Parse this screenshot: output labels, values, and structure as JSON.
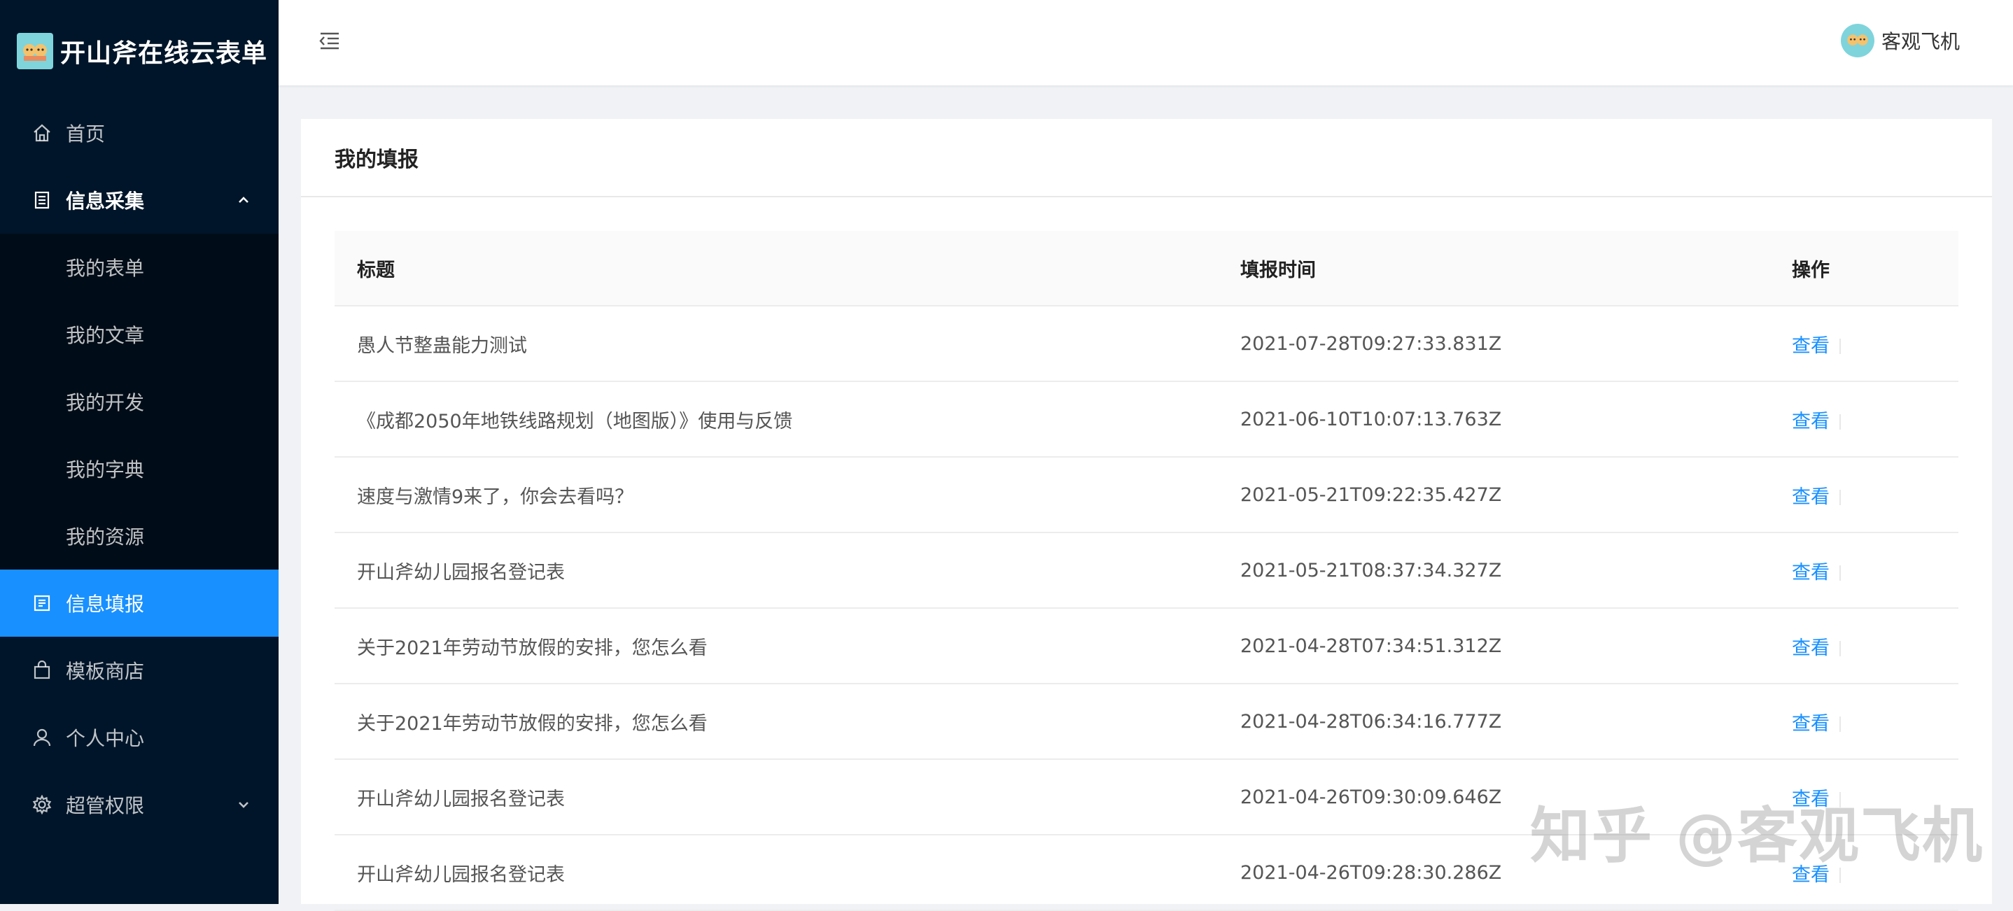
{
  "app": {
    "title": "开山斧在线云表单"
  },
  "sidebar": {
    "items": [
      {
        "label": "首页",
        "icon": "home-icon"
      },
      {
        "label": "信息采集",
        "icon": "document-icon",
        "expanded": true,
        "children": [
          {
            "label": "我的表单"
          },
          {
            "label": "我的文章"
          },
          {
            "label": "我的开发"
          },
          {
            "label": "我的字典"
          },
          {
            "label": "我的资源"
          }
        ]
      },
      {
        "label": "信息填报",
        "icon": "form-icon",
        "active": true
      },
      {
        "label": "模板商店",
        "icon": "shopping-bag-icon"
      },
      {
        "label": "个人中心",
        "icon": "user-icon"
      },
      {
        "label": "超管权限",
        "icon": "gear-icon",
        "expanded": false
      }
    ]
  },
  "header": {
    "username": "客观飞机"
  },
  "card": {
    "title": "我的填报"
  },
  "table": {
    "columns": [
      "标题",
      "填报时间",
      "操作"
    ],
    "action_label": "查看",
    "rows": [
      {
        "title": "愚人节整蛊能力测试",
        "time": "2021-07-28T09:27:33.831Z"
      },
      {
        "title": "《成都2050年地铁线路规划（地图版）》使用与反馈",
        "time": "2021-06-10T10:07:13.763Z"
      },
      {
        "title": "速度与激情9来了，你会去看吗？",
        "time": "2021-05-21T09:22:35.427Z"
      },
      {
        "title": "开山斧幼儿园报名登记表",
        "time": "2021-05-21T08:37:34.327Z"
      },
      {
        "title": "关于2021年劳动节放假的安排，您怎么看",
        "time": "2021-04-28T07:34:51.312Z"
      },
      {
        "title": "关于2021年劳动节放假的安排，您怎么看",
        "time": "2021-04-28T06:34:16.777Z"
      },
      {
        "title": "开山斧幼儿园报名登记表",
        "time": "2021-04-26T09:30:09.646Z"
      },
      {
        "title": "开山斧幼儿园报名登记表",
        "time": "2021-04-26T09:28:30.286Z"
      }
    ]
  },
  "watermark": "知乎 @客观飞机",
  "colors": {
    "sidebar_bg": "#001529",
    "submenu_bg": "#000c17",
    "accent": "#1890ff"
  }
}
